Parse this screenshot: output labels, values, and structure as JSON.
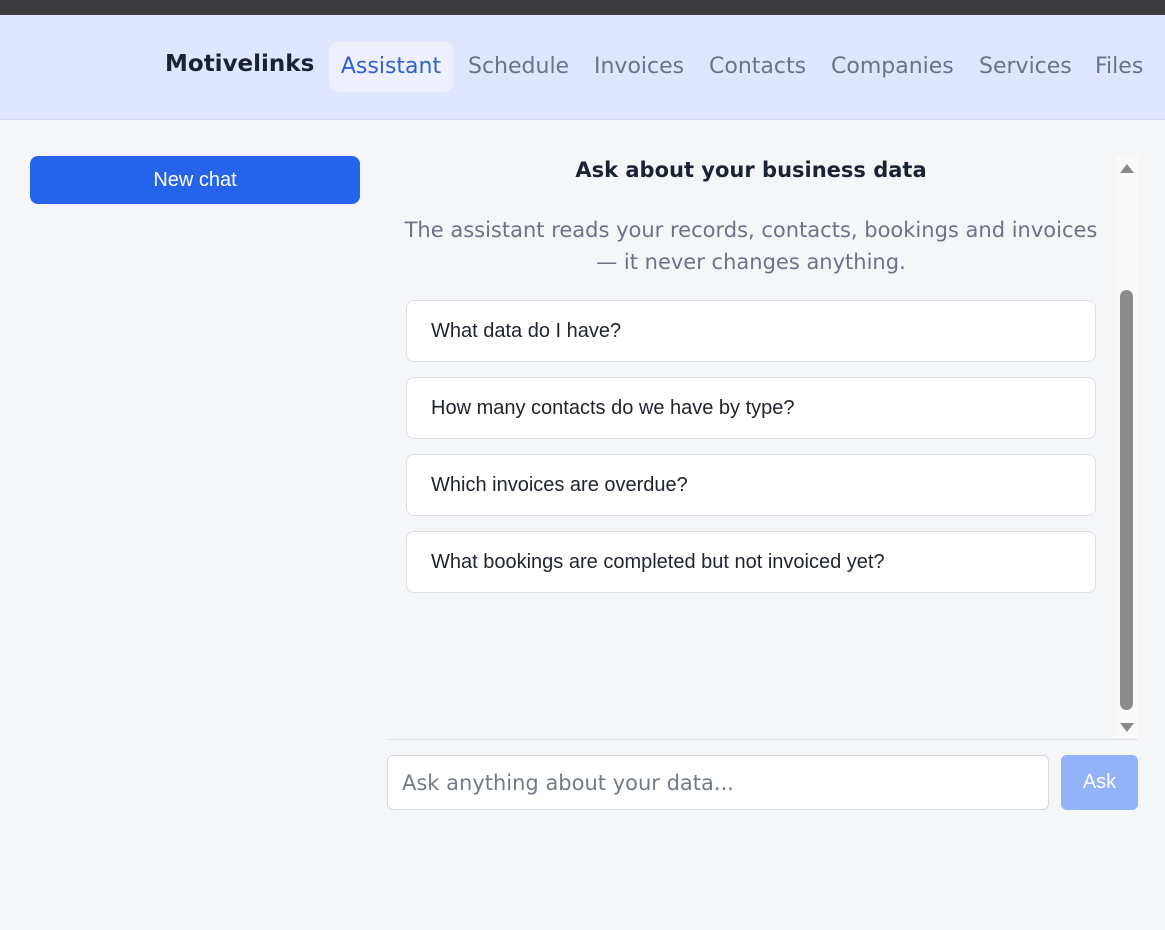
{
  "nav": {
    "brand": "Motivelinks",
    "tabs": [
      {
        "label": "Assistant",
        "active": true
      },
      {
        "label": "Schedule",
        "active": false
      },
      {
        "label": "Invoices",
        "active": false
      },
      {
        "label": "Contacts",
        "active": false
      },
      {
        "label": "Companies",
        "active": false
      },
      {
        "label": "Services",
        "active": false
      },
      {
        "label": "Files",
        "active": false
      }
    ]
  },
  "sidebar": {
    "new_chat_label": "New chat"
  },
  "chat": {
    "title": "Ask about your business data",
    "subtitle": "The assistant reads your records, contacts, bookings and invoices — it never changes anything.",
    "suggestions": [
      "What data do I have?",
      "How many contacts do we have by type?",
      "Which invoices are overdue?",
      "What bookings are completed but not invoiced yet?"
    ]
  },
  "composer": {
    "placeholder": "Ask anything about your data...",
    "value": "",
    "ask_label": "Ask"
  },
  "colors": {
    "accent": "#2563eb",
    "nav_background": "#e0e6ff",
    "active_tab_text": "#2f5fd0",
    "ask_button_disabled": "#93b2f7"
  }
}
